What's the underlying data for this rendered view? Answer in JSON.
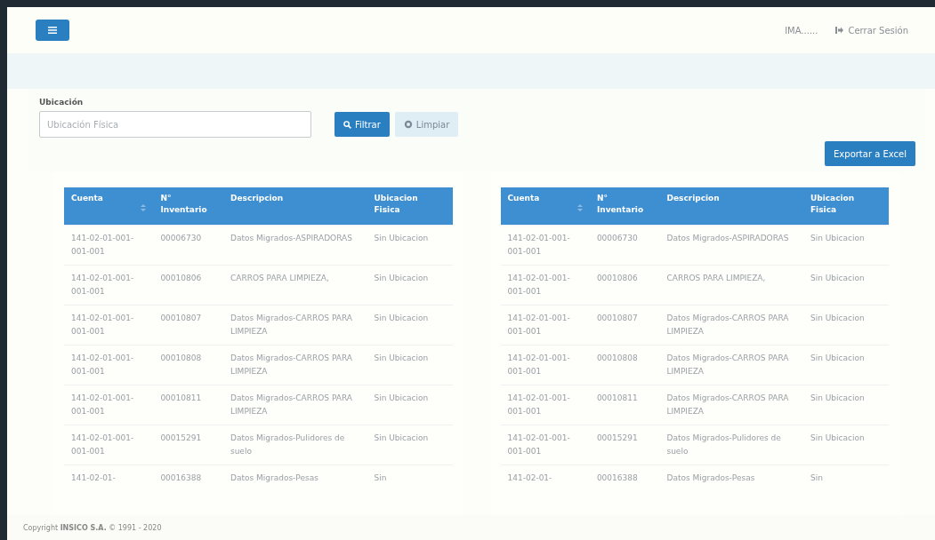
{
  "header": {
    "user": "IMA......",
    "logout": "Cerrar Sesión"
  },
  "filter": {
    "label": "Ubicación",
    "placeholder": "Ubicación Física",
    "filter_button": "Filtrar",
    "clear_button": "Limpiar"
  },
  "export_button": "Exportar a Excel",
  "tables": [
    {
      "columns": [
        "Cuenta",
        "N° Inventario",
        "Descripcion",
        "Ubicacion Fisica"
      ],
      "rows": [
        [
          "141-02-01-001-001-001",
          "00006730",
          "Datos Migrados-ASPIRADORAS",
          "Sin Ubicacion"
        ],
        [
          "141-02-01-001-001-001",
          "00010806",
          "CARROS PARA LIMPIEZA,",
          "Sin Ubicacion"
        ],
        [
          "141-02-01-001-001-001",
          "00010807",
          "Datos Migrados-CARROS PARA LIMPIEZA",
          "Sin Ubicacion"
        ],
        [
          "141-02-01-001-001-001",
          "00010808",
          "Datos Migrados-CARROS PARA LIMPIEZA",
          "Sin Ubicacion"
        ],
        [
          "141-02-01-001-001-001",
          "00010811",
          "Datos Migrados-CARROS PARA LIMPIEZA",
          "Sin Ubicacion"
        ],
        [
          "141-02-01-001-001-001",
          "00015291",
          "Datos Migrados-Pulidores de suelo",
          "Sin Ubicacion"
        ],
        [
          "141-02-01-",
          "00016388",
          "Datos Migrados-Pesas",
          "Sin"
        ]
      ]
    },
    {
      "columns": [
        "Cuenta",
        "N° Inventario",
        "Descripcion",
        "Ubicacion Fisica"
      ],
      "rows": [
        [
          "141-02-01-001-001-001",
          "00006730",
          "Datos Migrados-ASPIRADORAS",
          "Sin Ubicacion"
        ],
        [
          "141-02-01-001-001-001",
          "00010806",
          "CARROS PARA LIMPIEZA,",
          "Sin Ubicacion"
        ],
        [
          "141-02-01-001-001-001",
          "00010807",
          "Datos Migrados-CARROS PARA LIMPIEZA",
          "Sin Ubicacion"
        ],
        [
          "141-02-01-001-001-001",
          "00010808",
          "Datos Migrados-CARROS PARA LIMPIEZA",
          "Sin Ubicacion"
        ],
        [
          "141-02-01-001-001-001",
          "00010811",
          "Datos Migrados-CARROS PARA LIMPIEZA",
          "Sin Ubicacion"
        ],
        [
          "141-02-01-001-001-001",
          "00015291",
          "Datos Migrados-Pulidores de suelo",
          "Sin Ubicacion"
        ],
        [
          "141-02-01-",
          "00016388",
          "Datos Migrados-Pesas",
          "Sin"
        ]
      ]
    }
  ],
  "footer": "Copyright **INSICO S.A.** © 1991 - 2020"
}
